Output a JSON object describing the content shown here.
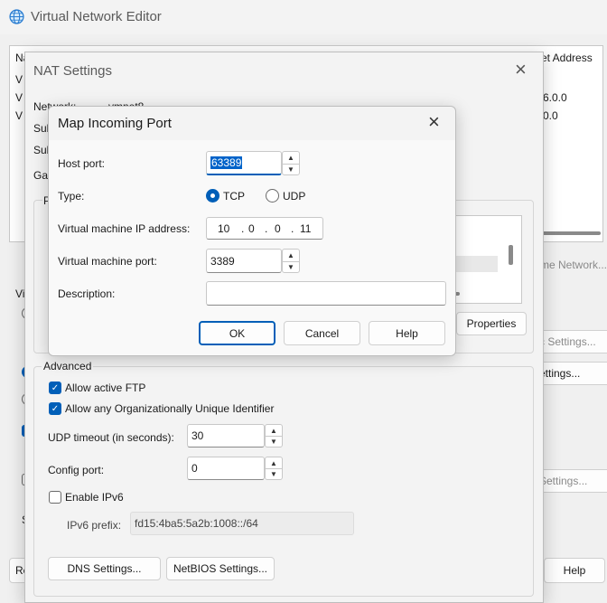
{
  "main_window": {
    "title": "Virtual Network Editor",
    "col_name_partial": "Na",
    "col_subnet_partial": "et Address",
    "row_prefix": "V",
    "row1_value": "6.0.0",
    "row2_value": "0.0",
    "right_btn_partial1": "me Network...",
    "right_btn_partial2": "c Settings...",
    "right_btn_partial3": "ettings...",
    "right_btn_partial4": "Settings...",
    "left_btn_partial": "Re",
    "help": "Help",
    "left_group_partial": "Vi",
    "left_label_partial": "S"
  },
  "nat_settings": {
    "title": "NAT Settings",
    "network_label": "Network:",
    "network_value": "vmnet8",
    "sub_label1": "Sub",
    "sub_label2": "Sub",
    "gat_label": "Gat",
    "port_group_partial": "P",
    "properties_button": "Properties",
    "advanced": {
      "title": "Advanced",
      "allow_ftp": "Allow active FTP",
      "allow_oui": "Allow any Organizationally Unique Identifier",
      "udp_label": "UDP timeout (in seconds):",
      "udp_value": "30",
      "config_port_label": "Config port:",
      "config_port_value": "0",
      "enable_ipv6": "Enable IPv6",
      "ipv6_label": "IPv6 prefix:",
      "ipv6_value": "fd15:4ba5:5a2b:1008::/64"
    },
    "dns_button": "DNS Settings...",
    "netbios_button": "NetBIOS Settings..."
  },
  "map_port": {
    "title": "Map Incoming Port",
    "host_port_label": "Host port:",
    "host_port_value": "63389",
    "type_label": "Type:",
    "tcp": "TCP",
    "udp": "UDP",
    "vm_ip_label": "Virtual machine IP address:",
    "ip_octets": [
      "10",
      "0",
      "0",
      "11"
    ],
    "ip_dot": ".",
    "vm_port_label": "Virtual machine port:",
    "vm_port_value": "3389",
    "description_label": "Description:",
    "description_value": "",
    "ok": "OK",
    "cancel": "Cancel",
    "help": "Help",
    "selected_type": "TCP"
  },
  "icons": {
    "close": "×",
    "spin_up": "▲",
    "spin_down": "▼",
    "check": "✓"
  }
}
